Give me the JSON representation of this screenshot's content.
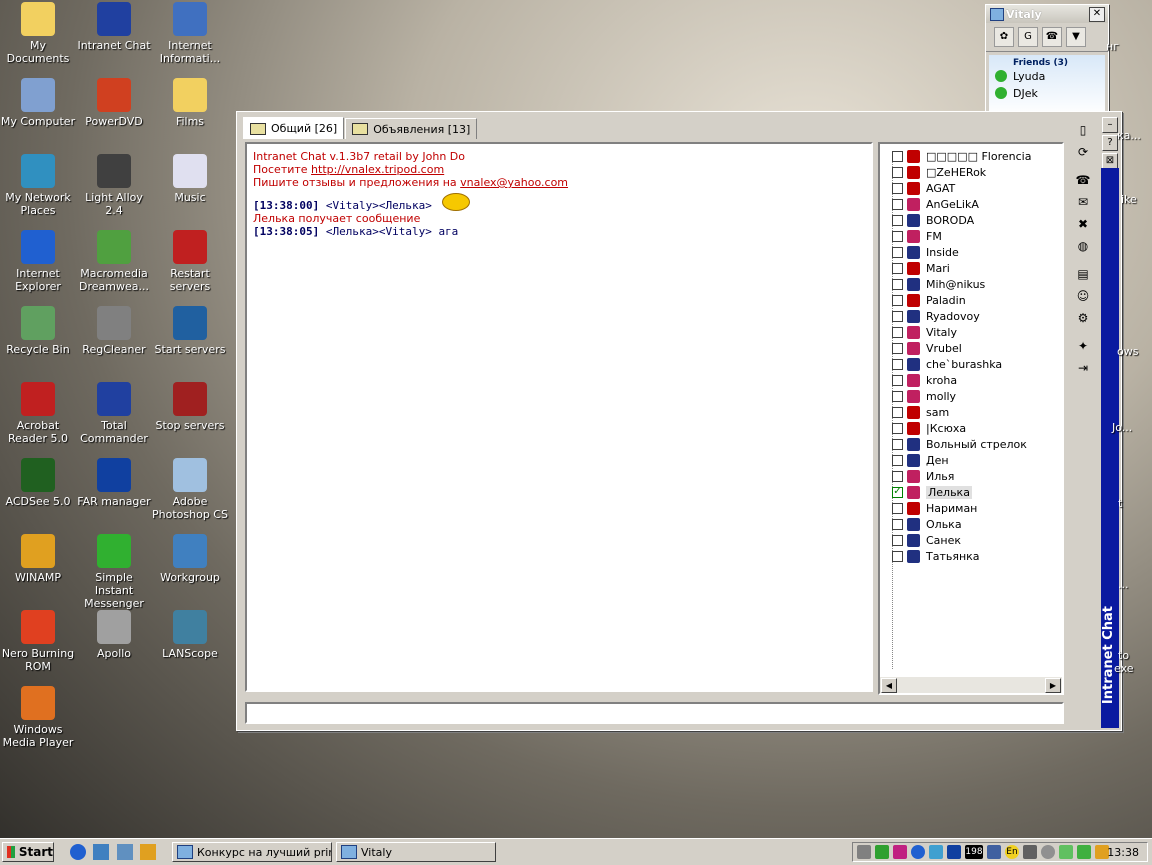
{
  "desktop": {
    "icons": [
      {
        "label": "My Documents",
        "icon": "my-documents-icon",
        "color": "#f2d060"
      },
      {
        "label": "Intranet Chat",
        "icon": "intranet-chat-icon",
        "color": "#2040a0"
      },
      {
        "label": "Internet Informati...",
        "icon": "internet-information-icon",
        "color": "#4070c0"
      },
      {
        "label": "My Computer",
        "icon": "my-computer-icon",
        "color": "#80a0d0"
      },
      {
        "label": "PowerDVD",
        "icon": "powerdvd-icon",
        "color": "#d04020"
      },
      {
        "label": "Films",
        "icon": "films-icon",
        "color": "#f2d060"
      },
      {
        "label": "My Network Places",
        "icon": "my-network-places-icon",
        "color": "#3090c0"
      },
      {
        "label": "Light Alloy 2.4",
        "icon": "light-alloy-icon",
        "color": "#404040"
      },
      {
        "label": "Music",
        "icon": "music-icon",
        "color": "#e0e0f0"
      },
      {
        "label": "Internet Explorer",
        "icon": "internet-explorer-icon",
        "color": "#2060d0"
      },
      {
        "label": "Macromedia Dreamwea...",
        "icon": "dreamweaver-icon",
        "color": "#50a040"
      },
      {
        "label": "Restart servers",
        "icon": "restart-servers-icon",
        "color": "#c02020"
      },
      {
        "label": "Recycle Bin",
        "icon": "recycle-bin-icon",
        "color": "#60a060"
      },
      {
        "label": "RegCleaner",
        "icon": "regcleaner-icon",
        "color": "#808080"
      },
      {
        "label": "Start servers",
        "icon": "start-servers-icon",
        "color": "#2060a0"
      },
      {
        "label": "Acrobat Reader 5.0",
        "icon": "acrobat-reader-icon",
        "color": "#c02020"
      },
      {
        "label": "Total Commander",
        "icon": "total-commander-icon",
        "color": "#2040a0"
      },
      {
        "label": "Stop servers",
        "icon": "stop-servers-icon",
        "color": "#a02020"
      },
      {
        "label": "ACDSee 5.0",
        "icon": "acdsee-icon",
        "color": "#206020"
      },
      {
        "label": "FAR manager",
        "icon": "far-manager-icon",
        "color": "#1040a0"
      },
      {
        "label": "Adobe Photoshop CS",
        "icon": "photoshop-icon",
        "color": "#a0c0e0"
      },
      {
        "label": "WINAMP",
        "icon": "winamp-icon",
        "color": "#e0a020"
      },
      {
        "label": "Simple Instant Messenger",
        "icon": "sim-icon",
        "color": "#30b030"
      },
      {
        "label": "Workgroup",
        "icon": "workgroup-icon",
        "color": "#4080c0"
      },
      {
        "label": "Nero Burning ROM",
        "icon": "nero-icon",
        "color": "#e04020"
      },
      {
        "label": "Apollo",
        "icon": "apollo-icon",
        "color": "#a0a0a0"
      },
      {
        "label": "LANScope",
        "icon": "lanscope-icon",
        "color": "#4080a0"
      },
      {
        "label": "Windows Media Player",
        "icon": "windows-media-player-icon",
        "color": "#e07020"
      }
    ],
    "edge_labels": [
      "нг",
      "ка...",
      "ike",
      "ows",
      "Jo...",
      "t",
      "to",
      "exe",
      "..."
    ]
  },
  "buddy_window": {
    "title": "Vitaly",
    "group": "Friends (3)",
    "buddies": [
      "Lyuda",
      "DJek"
    ]
  },
  "chat_window": {
    "tabs": [
      {
        "label": "Общий [26]",
        "active": true
      },
      {
        "label": "Объявления [13]",
        "active": false
      }
    ],
    "log": {
      "line1": "Intranet Chat v.1.3b7 retail by John Do",
      "line2_prefix": "Посетите ",
      "line2_link": "http://vnalex.tripod.com",
      "line3_prefix": "Пишите отзывы и предложения на ",
      "line3_link": "vnalex@yahoo.com",
      "msg1_time": "[13:38:00]",
      "msg1_text": " <Vitaly><Лелька>",
      "notice": "Лелька получает сообщение",
      "msg2_time": "[13:38:05]",
      "msg2_text": " <Лелька><Vitaly> ага"
    },
    "users": [
      {
        "name": "□□□□□ Florencia",
        "status": "off"
      },
      {
        "name": "□ZeHERok",
        "status": "off"
      },
      {
        "name": "AGAT",
        "status": "off"
      },
      {
        "name": "AnGeLikA",
        "status": "f"
      },
      {
        "name": "BORODA",
        "status": "m"
      },
      {
        "name": "FM",
        "status": "f"
      },
      {
        "name": "Inside",
        "status": "m"
      },
      {
        "name": "Mari",
        "status": "off"
      },
      {
        "name": "Mih@nikus",
        "status": "m"
      },
      {
        "name": "Paladin",
        "status": "off"
      },
      {
        "name": "Ryadovoy",
        "status": "m"
      },
      {
        "name": "Vitaly",
        "status": "f"
      },
      {
        "name": "Vrubel",
        "status": "f"
      },
      {
        "name": "che`burashka",
        "status": "m"
      },
      {
        "name": "kroha",
        "status": "f"
      },
      {
        "name": "molly",
        "status": "f"
      },
      {
        "name": "sam",
        "status": "off"
      },
      {
        "name": "|Ксюха",
        "status": "off"
      },
      {
        "name": "Вольный стрелок",
        "status": "m"
      },
      {
        "name": "Ден",
        "status": "m"
      },
      {
        "name": "Илья",
        "status": "f"
      },
      {
        "name": "Лелька",
        "status": "f",
        "selected": true
      },
      {
        "name": "Нариман",
        "status": "off"
      },
      {
        "name": "Олька",
        "status": "m"
      },
      {
        "name": "Санек",
        "status": "m"
      },
      {
        "name": "Татьянка",
        "status": "m"
      }
    ],
    "side_tools": [
      "new-doc-icon",
      "refresh-icon",
      "phone-icon",
      "mail-icon",
      "delete-icon",
      "chat-bubble-icon",
      "message-icon",
      "smiley-icon",
      "settings-icon",
      "bulb-icon",
      "exit-icon"
    ],
    "rail_title": "Intranet Chat",
    "rail_controls": [
      "–",
      "?",
      "⊠"
    ]
  },
  "taskbar": {
    "start_label": "Start",
    "tasks": [
      "Конкурс на лучший prin...",
      "Vitaly"
    ],
    "tray_counter": "198",
    "tray_lang": "En",
    "clock": "13:38"
  }
}
